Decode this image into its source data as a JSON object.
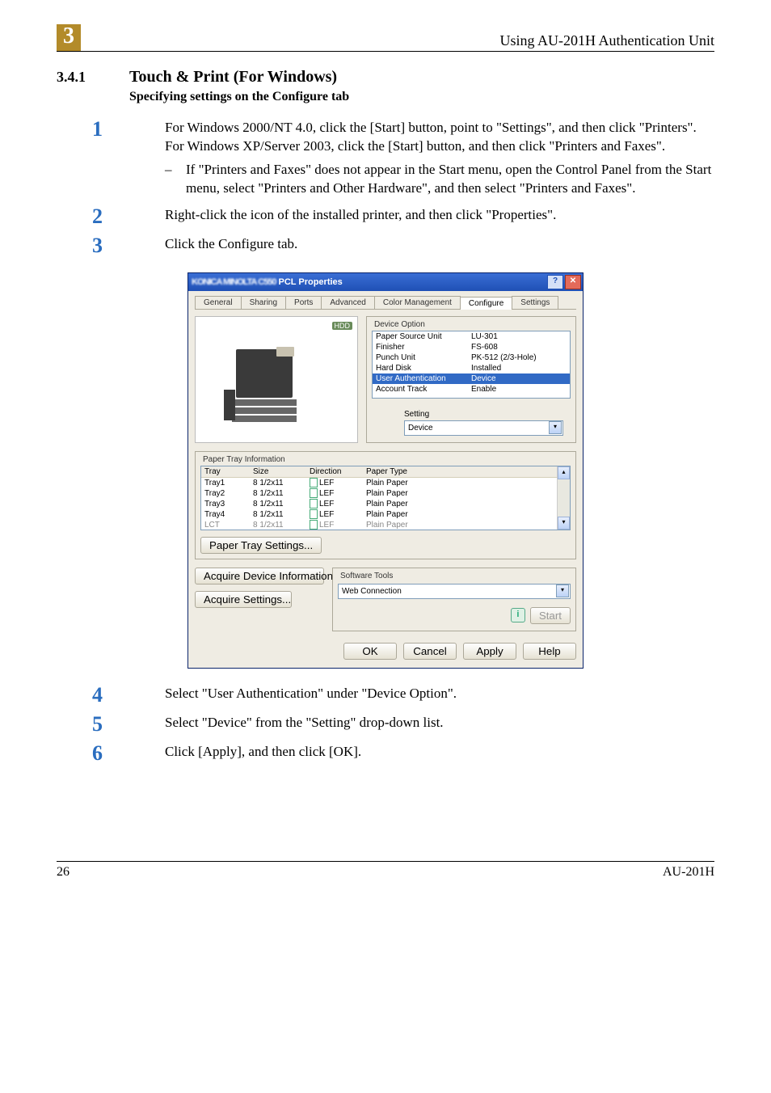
{
  "header": {
    "chapter_number": "3",
    "running_title": "Using AU-201H Authentication Unit"
  },
  "section": {
    "number": "3.4.1",
    "title": "Touch & Print (For Windows)",
    "subtitle": "Specifying settings on the Configure tab"
  },
  "steps": {
    "s1a": "For Windows 2000/NT 4.0, click the [Start] button, point to \"Settings\", and then click \"Printers\".",
    "s1b": "For Windows XP/Server 2003, click the [Start] button, and then click \"Printers and Faxes\".",
    "s1sub": "If \"Printers and Faxes\" does not appear in the Start menu, open the Control Panel from the Start menu, select \"Printers and Other Hardware\", and then select \"Printers and Faxes\".",
    "s2": "Right-click the icon of the installed printer, and then click \"Properties\".",
    "s3": "Click the Configure tab.",
    "s4": "Select \"User Authentication\" under \"Device Option\".",
    "s5": "Select \"Device\" from the \"Setting\" drop-down list.",
    "s6": "Click [Apply], and then click [OK]."
  },
  "dialog": {
    "title_suffix": " PCL Properties",
    "hdd_badge": "HDD",
    "tabs": [
      "General",
      "Sharing",
      "Ports",
      "Advanced",
      "Color Management",
      "Configure",
      "Settings"
    ],
    "device_option_label": "Device Option",
    "options": [
      {
        "k": "Paper Source Unit",
        "v": "LU-301"
      },
      {
        "k": "Finisher",
        "v": "FS-608"
      },
      {
        "k": "Punch Unit",
        "v": "PK-512 (2/3-Hole)"
      },
      {
        "k": "Hard Disk",
        "v": "Installed"
      },
      {
        "k": "User Authentication",
        "v": "Device"
      },
      {
        "k": "Account Track",
        "v": "Enable"
      }
    ],
    "selected_option_index": 4,
    "setting_label": "Setting",
    "setting_value": "Device",
    "paper_tray_label": "Paper Tray Information",
    "tray_cols": [
      "Tray",
      "Size",
      "Direction",
      "Paper Type"
    ],
    "tray_rows": [
      {
        "tray": "Tray1",
        "size": "8 1/2x11",
        "dir": "LEF",
        "type": "Plain Paper"
      },
      {
        "tray": "Tray2",
        "size": "8 1/2x11",
        "dir": "LEF",
        "type": "Plain Paper"
      },
      {
        "tray": "Tray3",
        "size": "8 1/2x11",
        "dir": "LEF",
        "type": "Plain Paper"
      },
      {
        "tray": "Tray4",
        "size": "8 1/2x11",
        "dir": "LEF",
        "type": "Plain Paper"
      },
      {
        "tray": "LCT",
        "size": "8 1/2x11",
        "dir": "LEF",
        "type": "Plain Paper"
      }
    ],
    "paper_tray_settings_btn": "Paper Tray Settings...",
    "acquire_device_btn": "Acquire Device Information",
    "acquire_settings_btn": "Acquire Settings...",
    "software_tools_label": "Software Tools",
    "software_tool_value": "Web Connection",
    "start_btn": "Start",
    "ok": "OK",
    "cancel": "Cancel",
    "apply": "Apply",
    "help": "Help"
  },
  "footer": {
    "page": "26",
    "doc": "AU-201H"
  }
}
